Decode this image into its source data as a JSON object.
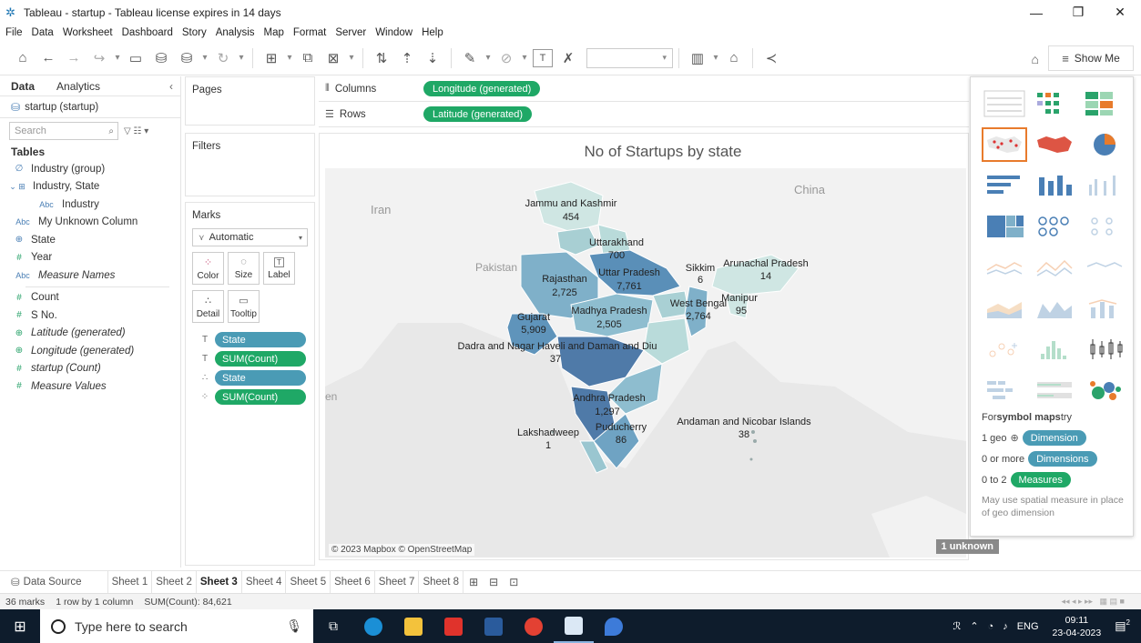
{
  "window": {
    "title": "Tableau - startup - Tableau license expires in 14 days"
  },
  "menu": [
    "File",
    "Data",
    "Worksheet",
    "Dashboard",
    "Story",
    "Analysis",
    "Map",
    "Format",
    "Server",
    "Window",
    "Help"
  ],
  "toolbar": {
    "show_me_label": "Show Me"
  },
  "data_pane": {
    "tabs": [
      "Data",
      "Analytics"
    ],
    "datasource": "startup (startup)",
    "search_placeholder": "Search",
    "tables_heading": "Tables",
    "fields": [
      {
        "icon": "∅",
        "label": "Industry (group)",
        "indent": 1,
        "italic": false,
        "color": "blue"
      },
      {
        "icon": "⌄ ⊞",
        "label": "Industry, State",
        "indent": 0,
        "italic": false,
        "color": "blue"
      },
      {
        "icon": "Abc",
        "label": "Industry",
        "indent": 2,
        "italic": false,
        "color": "blue"
      },
      {
        "icon": "Abc",
        "label": "My Unknown Column",
        "indent": 1,
        "italic": false,
        "color": "blue"
      },
      {
        "icon": "⊕",
        "label": "State",
        "indent": 1,
        "italic": false,
        "color": "blue"
      },
      {
        "icon": "#",
        "label": "Year",
        "indent": 1,
        "italic": false,
        "color": "green"
      },
      {
        "icon": "Abc",
        "label": "Measure Names",
        "indent": 1,
        "italic": true,
        "color": "blue"
      },
      {
        "icon": "#",
        "label": "Count",
        "indent": 1,
        "italic": false,
        "color": "green"
      },
      {
        "icon": "#",
        "label": "S No.",
        "indent": 1,
        "italic": false,
        "color": "green"
      },
      {
        "icon": "⊕",
        "label": "Latitude (generated)",
        "indent": 1,
        "italic": true,
        "color": "green"
      },
      {
        "icon": "⊕",
        "label": "Longitude (generated)",
        "indent": 1,
        "italic": true,
        "color": "green"
      },
      {
        "icon": "#",
        "label": "startup (Count)",
        "indent": 1,
        "italic": true,
        "color": "green"
      },
      {
        "icon": "#",
        "label": "Measure Values",
        "indent": 1,
        "italic": true,
        "color": "green"
      }
    ]
  },
  "shelves": {
    "pages": "Pages",
    "filters": "Filters",
    "marks": "Marks",
    "marks_type": "Automatic",
    "mark_buttons": [
      {
        "icon": "⁘",
        "label": "Color"
      },
      {
        "icon": "◌",
        "label": "Size"
      },
      {
        "icon": "T",
        "label": "Label"
      },
      {
        "icon": "∴",
        "label": "Detail"
      },
      {
        "icon": "▭",
        "label": "Tooltip"
      }
    ],
    "mark_pills": [
      {
        "icon": "T",
        "label": "State",
        "color": "blue"
      },
      {
        "icon": "T",
        "label": "SUM(Count)",
        "color": "green"
      },
      {
        "icon": "∴",
        "label": "State",
        "color": "blue"
      },
      {
        "icon": "⁘",
        "label": "SUM(Count)",
        "color": "green"
      }
    ],
    "columns_label": "Columns",
    "columns_pill": "Longitude (generated)",
    "rows_label": "Rows",
    "rows_pill": "Latitude (generated)"
  },
  "view": {
    "title": "No of Startups by state",
    "credit": "© 2023 Mapbox © OpenStreetMap",
    "unknown_badge": "1 unknown",
    "background_labels": [
      "China",
      "Iran",
      "Pakistan",
      "en"
    ],
    "state_labels": [
      {
        "name": "Jammu and Kashmir",
        "value": "454"
      },
      {
        "name": "Uttarakhand",
        "value": "700"
      },
      {
        "name": "Uttar Pradesh",
        "value": "7,761"
      },
      {
        "name": "Rajasthan",
        "value": "2,725"
      },
      {
        "name": "Sikkim",
        "value": "6"
      },
      {
        "name": "Arunachal Pradesh",
        "value": "14"
      },
      {
        "name": "West Bengal",
        "value": "2,764"
      },
      {
        "name": "Manipur",
        "value": "95"
      },
      {
        "name": "Gujarat",
        "value": "5,909"
      },
      {
        "name": "Madhya Pradesh",
        "value": "2,505"
      },
      {
        "name": "Dadra and Nagar Haveli and Daman and Diu",
        "value": "37"
      },
      {
        "name": "Andhra Pradesh",
        "value": "1,297"
      },
      {
        "name": "Lakshadweep",
        "value": "1"
      },
      {
        "name": "Puducherry",
        "value": "86"
      },
      {
        "name": "Andaman and Nicobar Islands",
        "value": "38"
      }
    ]
  },
  "show_me": {
    "hint_title_prefix": "For ",
    "hint_title_bold": "symbol maps",
    "hint_title_suffix": " try",
    "line1_prefix": "1 geo",
    "line1_pill": "Dimension",
    "line2_prefix": "0 or more",
    "line2_pill": "Dimensions",
    "line3_prefix": "0 to 2",
    "line3_pill": "Measures",
    "note": "May use spatial measure in place of geo dimension"
  },
  "sheet_tabs": {
    "data_source": "Data Source",
    "sheets": [
      "Sheet 1",
      "Sheet 2",
      "Sheet 3",
      "Sheet 4",
      "Sheet 5",
      "Sheet 6",
      "Sheet 7",
      "Sheet 8"
    ],
    "active": "Sheet 3"
  },
  "status": {
    "marks": "36 marks",
    "grid": "1 row by 1 column",
    "sum": "SUM(Count): 84,621"
  },
  "taskbar": {
    "search_placeholder": "Type here to search",
    "language": "ENG",
    "time": "09:11",
    "date": "23-04-2023",
    "notification_count": "2"
  },
  "colors": {
    "green_pill": "#1fa866",
    "blue_pill": "#4a9bb5",
    "map_dark": "#4f7aa8",
    "map_light": "#cfe6e3"
  }
}
